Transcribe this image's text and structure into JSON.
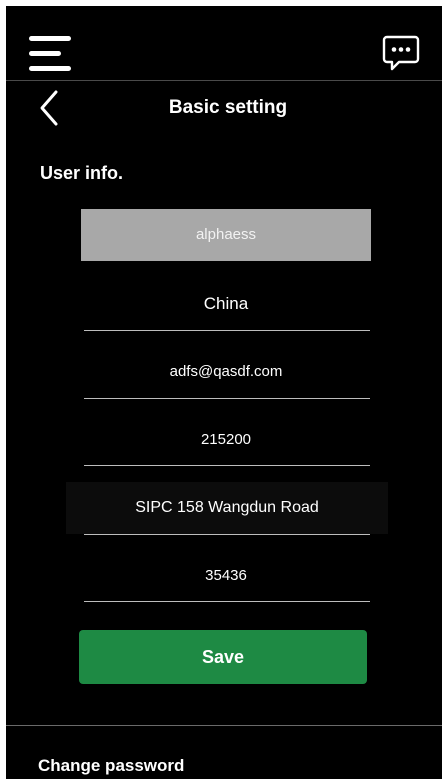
{
  "header": {
    "menu_icon": "hamburger-menu-icon",
    "chat_icon": "chat-bubble-icon",
    "back_icon": "chevron-left-icon",
    "title": "Basic setting"
  },
  "user_info": {
    "section_title": "User info.",
    "username": "alphaess",
    "country": "China",
    "email": "adfs@qasdf.com",
    "postcode": "215200",
    "address": "SIPC 158 Wangdun Road",
    "phone": "35436"
  },
  "actions": {
    "save_label": "Save"
  },
  "password": {
    "section_title": "Change password"
  },
  "colors": {
    "background": "#000000",
    "save_button": "#1e8a44",
    "readonly_field": "#a8a8a8",
    "text": "#ffffff"
  }
}
